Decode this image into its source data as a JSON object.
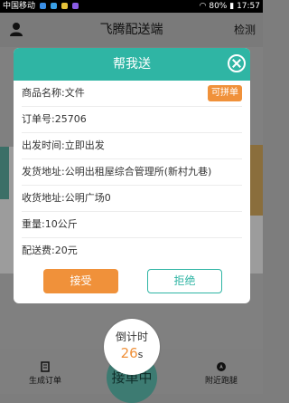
{
  "status_bar": {
    "carrier": "中国移动",
    "battery": "80%",
    "time": "17:57"
  },
  "app_bar": {
    "title": "飞腾配送端",
    "right_action": "检测"
  },
  "modal": {
    "title": "帮我送",
    "rows": [
      {
        "label": "商品名称:文件",
        "badge": "可拼单"
      },
      {
        "label": "订单号:25706"
      },
      {
        "label": "出发时间:立即出发"
      },
      {
        "label": "发货地址:公明出租屋综合管理所(新村九巷)"
      },
      {
        "label": "收货地址:公明广场0"
      },
      {
        "label": "重量:10公斤"
      },
      {
        "label": "配送费:20元"
      }
    ],
    "accept_label": "接受",
    "reject_label": "拒绝"
  },
  "countdown": {
    "label": "倒计时",
    "seconds": "26",
    "unit": "s"
  },
  "bottom_nav": {
    "left": "生成订单",
    "center": "接单中",
    "right": "附近跑腿"
  },
  "colors": {
    "accent": "#2fb5a4",
    "orange": "#f0913a"
  }
}
